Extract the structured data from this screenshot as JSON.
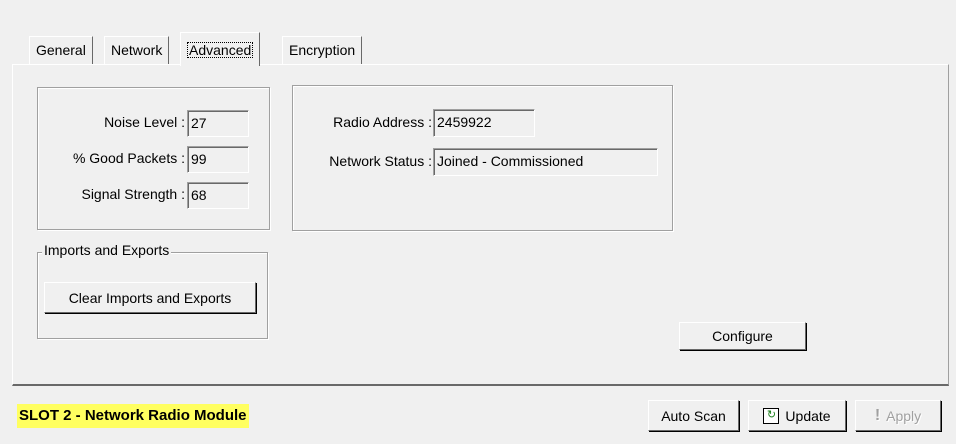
{
  "tabs": [
    "General",
    "Network",
    "Advanced",
    "Encryption"
  ],
  "active_tab": "Advanced",
  "stats": {
    "noise_level_label": "Noise Level :",
    "noise_level_value": "27",
    "good_packets_label": "% Good Packets :",
    "good_packets_value": "99",
    "signal_strength_label": "Signal Strength :",
    "signal_strength_value": "68"
  },
  "radio": {
    "address_label": "Radio Address :",
    "address_value": "2459922",
    "status_label": "Network Status :",
    "status_value": "Joined - Commissioned"
  },
  "imports_exports": {
    "group_title": "Imports and Exports",
    "clear_button": "Clear Imports and Exports"
  },
  "configure_button": "Configure",
  "footer": {
    "slot_title": "SLOT 2 - Network Radio Module",
    "auto_scan_button": "Auto Scan",
    "update_button": "Update",
    "apply_button": "Apply"
  },
  "colors": {
    "background": "#f0f0f0",
    "slot_highlight": "#ffff60"
  },
  "icons": {
    "update": "refresh-icon",
    "apply": "exclamation-icon"
  }
}
